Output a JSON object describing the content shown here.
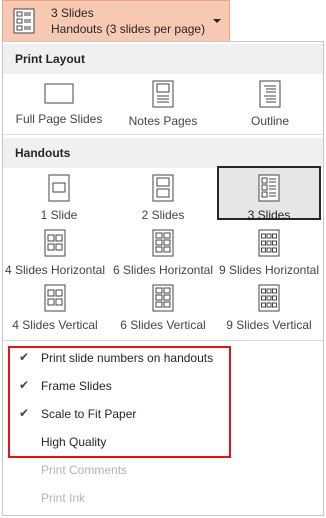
{
  "dropdown": {
    "line1": "3 Slides",
    "line2": "Handouts (3 slides per page)",
    "icon": "three-slides-handout-icon"
  },
  "print_layout": {
    "heading": "Print Layout",
    "items": [
      {
        "label": "Full Page Slides",
        "icon": "full-page-slide-icon"
      },
      {
        "label": "Notes Pages",
        "icon": "notes-page-icon"
      },
      {
        "label": "Outline",
        "icon": "outline-icon"
      }
    ]
  },
  "handouts": {
    "heading": "Handouts",
    "items": [
      {
        "label": "1 Slide",
        "icon": "one-slide-icon"
      },
      {
        "label": "2 Slides",
        "icon": "two-slides-icon"
      },
      {
        "label": "3 Slides",
        "icon": "three-slides-icon",
        "selected": true
      },
      {
        "label": "4 Slides Horizontal",
        "icon": "four-slides-horizontal-icon"
      },
      {
        "label": "6 Slides Horizontal",
        "icon": "six-slides-horizontal-icon"
      },
      {
        "label": "9 Slides Horizontal",
        "icon": "nine-slides-horizontal-icon"
      },
      {
        "label": "4 Slides Vertical",
        "icon": "four-slides-vertical-icon"
      },
      {
        "label": "6 Slides Vertical",
        "icon": "six-slides-vertical-icon"
      },
      {
        "label": "9 Slides Vertical",
        "icon": "nine-slides-vertical-icon"
      }
    ]
  },
  "options": [
    {
      "label": "Print slide numbers on handouts",
      "checked": true,
      "enabled": true
    },
    {
      "label": "Frame Slides",
      "checked": true,
      "enabled": true
    },
    {
      "label": "Scale to Fit Paper",
      "checked": true,
      "enabled": true
    },
    {
      "label": "High Quality",
      "checked": false,
      "enabled": true
    },
    {
      "label": "Print Comments",
      "checked": false,
      "enabled": false
    },
    {
      "label": "Print Ink",
      "checked": false,
      "enabled": false
    }
  ],
  "check_glyph": "✔",
  "colors": {
    "dropdown_bg": "#f8c9b2",
    "section_bg": "#f0f0f0",
    "selected_bg": "#e6e6e6",
    "highlight_box": "#e0141c",
    "disabled_text": "#b3b3b3"
  }
}
